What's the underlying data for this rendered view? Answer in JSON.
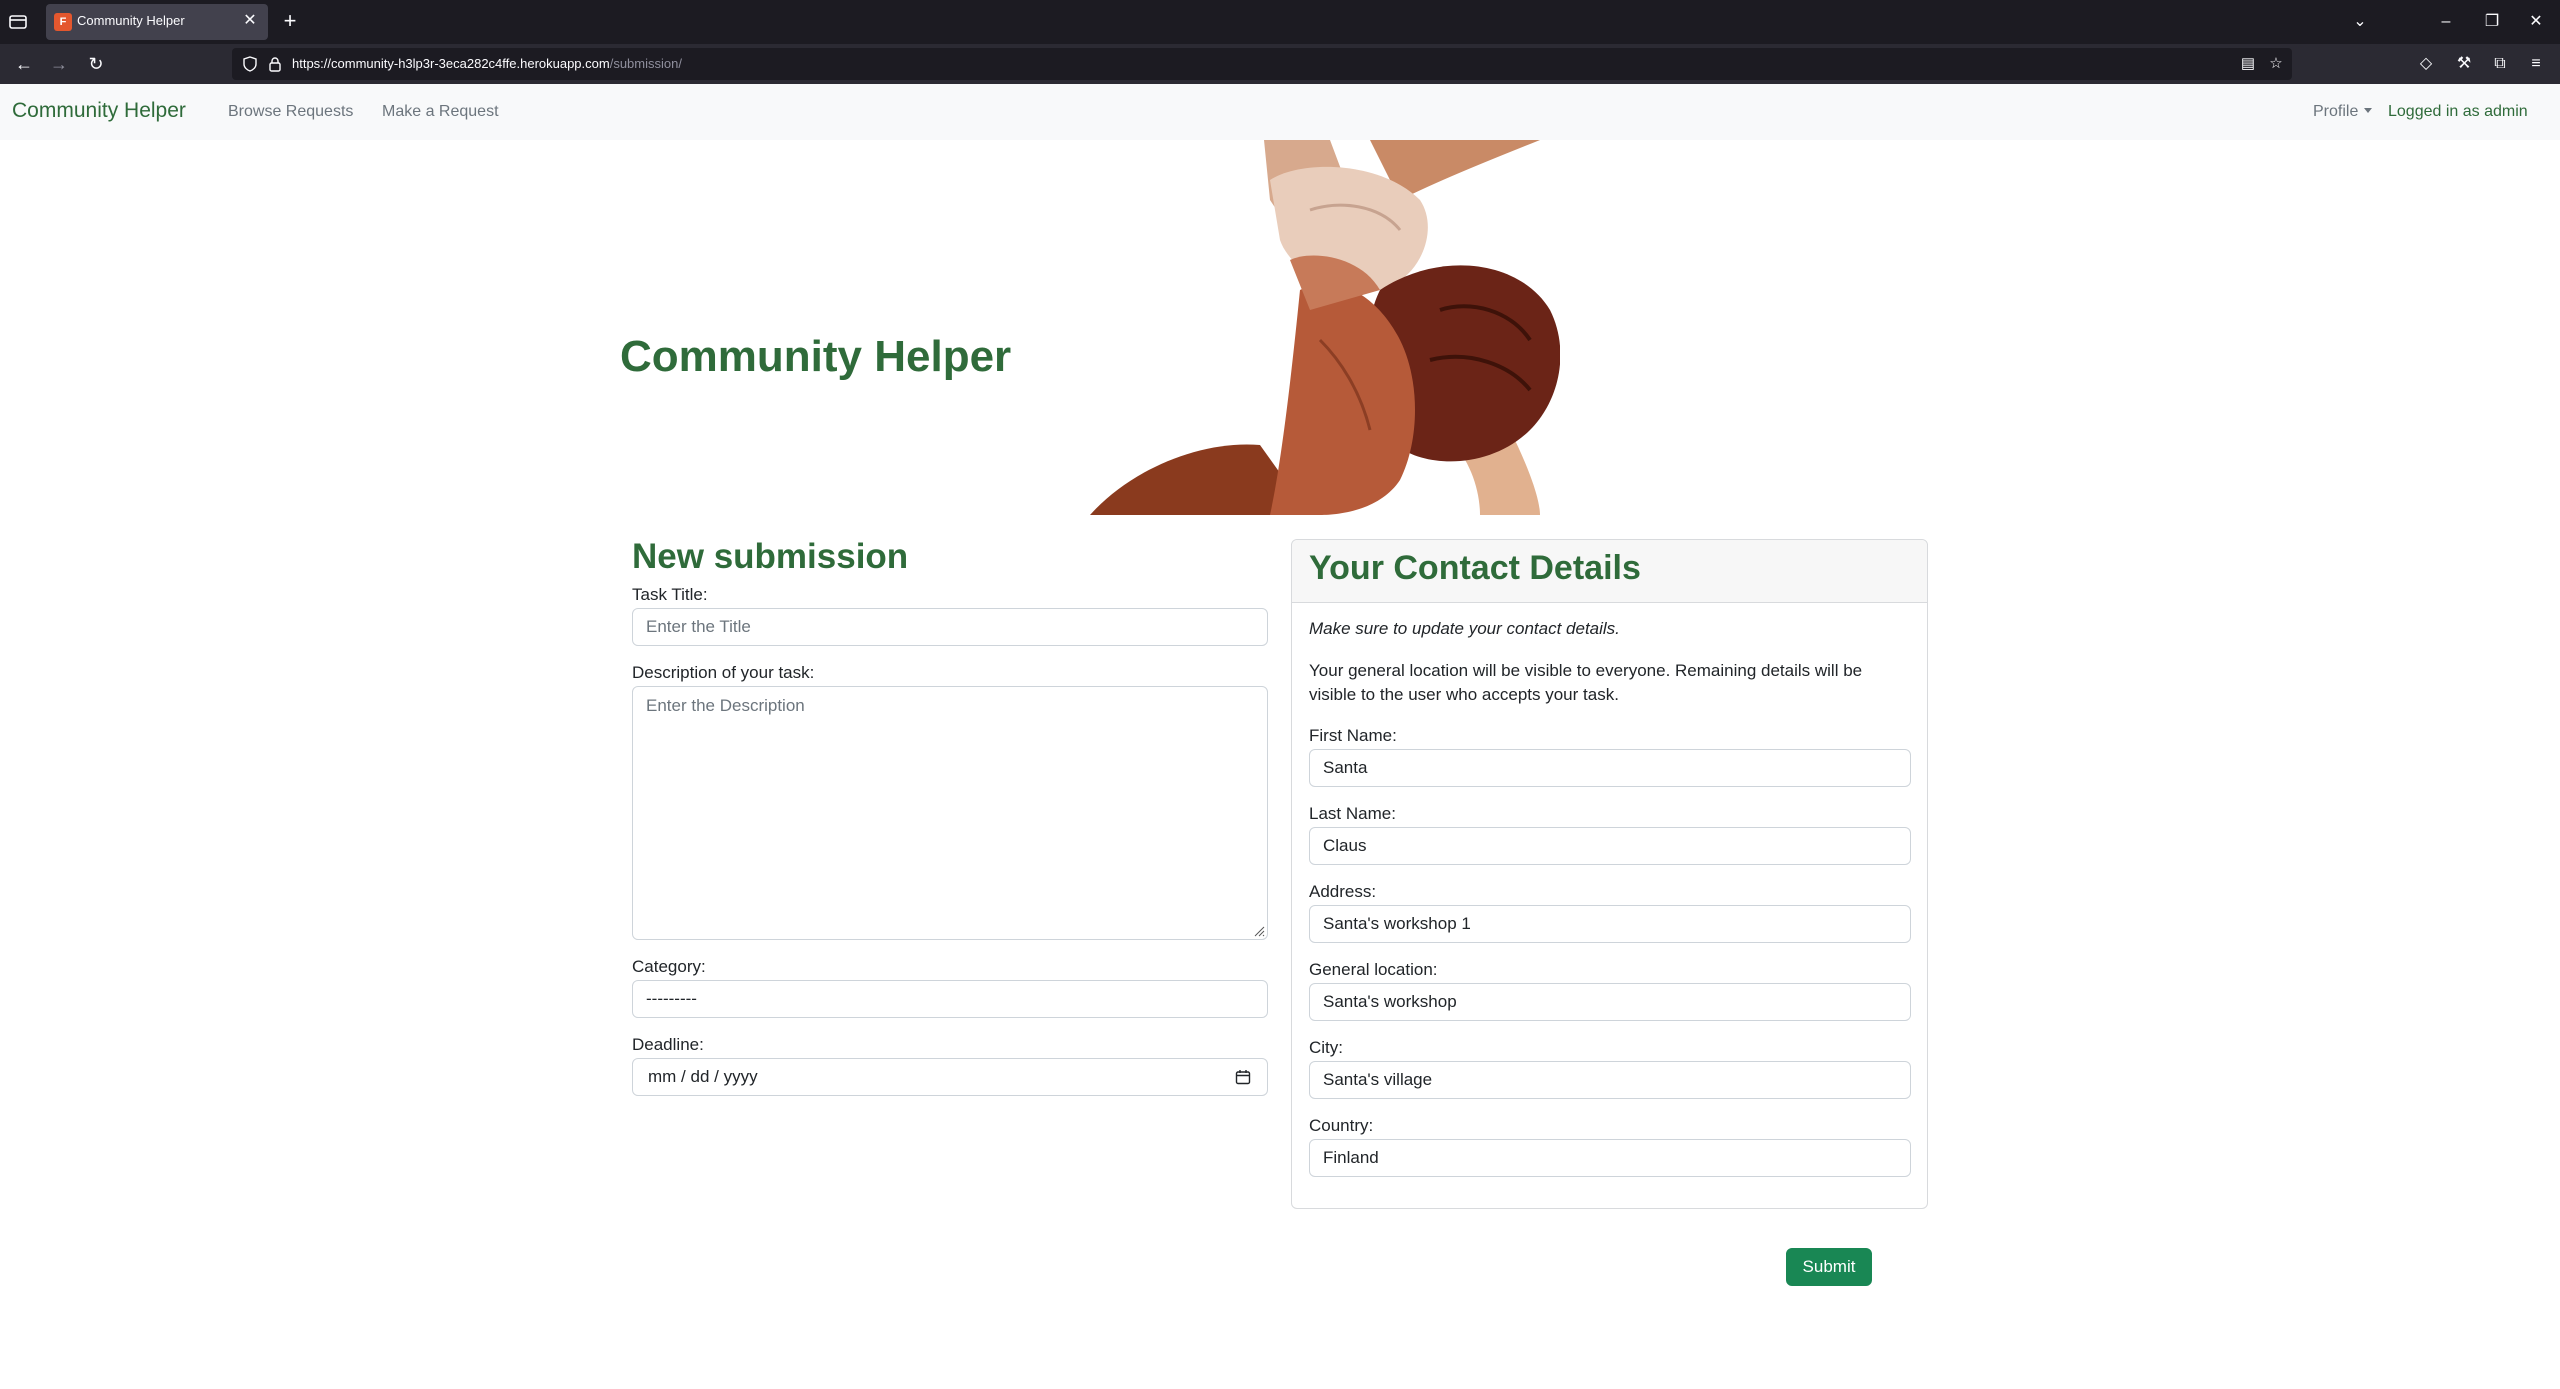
{
  "browser": {
    "tab_title": "Community Helper",
    "url_host": "https://community-h3lp3r-3eca282c4ffe.herokuapp.com",
    "url_path": "/submission/"
  },
  "nav": {
    "brand": "Community Helper",
    "links": [
      "Browse Requests",
      "Make a Request"
    ],
    "profile": "Profile",
    "status": "Logged in as admin"
  },
  "hero": {
    "title": "Community Helper"
  },
  "form": {
    "title": "New submission",
    "task_title_label": "Task Title:",
    "task_title_placeholder": "Enter the Title",
    "description_label": "Description of your task:",
    "description_placeholder": "Enter the Description",
    "category_label": "Category:",
    "category_value": "---------",
    "deadline_label": "Deadline:",
    "deadline_placeholder": "mm / dd / yyyy"
  },
  "contact": {
    "title": "Your Contact Details",
    "note": "Make sure to update your contact details.",
    "info": "Your general location will be visible to everyone. Remaining details will be visible to the user who accepts your task.",
    "fields": [
      {
        "label": "First Name:",
        "value": "Santa"
      },
      {
        "label": "Last Name:",
        "value": "Claus"
      },
      {
        "label": "Address:",
        "value": "Santa's workshop 1"
      },
      {
        "label": "General location:",
        "value": "Santa's workshop"
      },
      {
        "label": "City:",
        "value": "Santa's village"
      },
      {
        "label": "Country:",
        "value": "Finland"
      }
    ]
  },
  "submit_label": "Submit",
  "colors": {
    "brand_green": "#2f6b3a",
    "submit_green": "#198754"
  }
}
